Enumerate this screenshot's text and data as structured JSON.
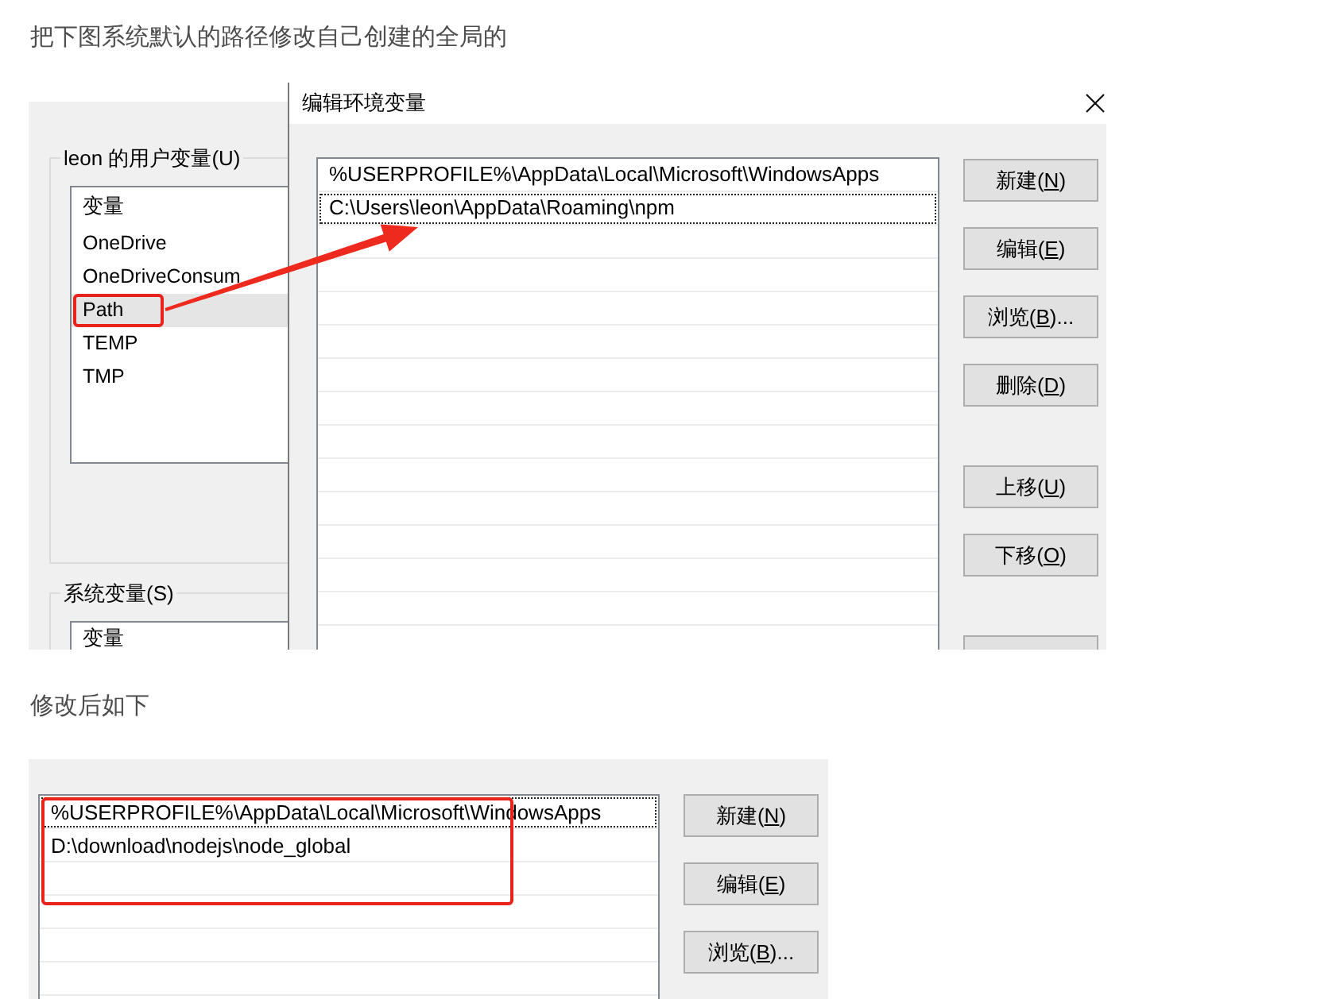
{
  "intro_text": "把下图系统默认的路径修改自己创建的全局的",
  "before_screenshot": {
    "user_variables": {
      "title": "leon 的用户变量(U)",
      "header": "变量",
      "items": [
        {
          "name": "OneDrive",
          "selected": false,
          "highlighted": false
        },
        {
          "name": "OneDriveConsum",
          "selected": false,
          "highlighted": false
        },
        {
          "name": "Path",
          "selected": true,
          "highlighted": true
        },
        {
          "name": "TEMP",
          "selected": false,
          "highlighted": false
        },
        {
          "name": "TMP",
          "selected": false,
          "highlighted": false
        }
      ]
    },
    "system_variables": {
      "title": "系统变量(S)",
      "header": "变量"
    },
    "dialog": {
      "title": "编辑环境变量",
      "paths": [
        {
          "value": "%USERPROFILE%\\AppData\\Local\\Microsoft\\WindowsApps",
          "focused": false
        },
        {
          "value": "C:\\Users\\leon\\AppData\\Roaming\\npm",
          "focused": true
        }
      ],
      "button_groups": [
        [
          {
            "before": "新建(",
            "key": "N",
            "after": ")"
          },
          {
            "before": "编辑(",
            "key": "E",
            "after": ")"
          },
          {
            "before": "浏览(",
            "key": "B",
            "after": ")..."
          },
          {
            "before": "删除(",
            "key": "D",
            "after": ")"
          }
        ],
        [
          {
            "before": "上移(",
            "key": "U",
            "after": ")"
          },
          {
            "before": "下移(",
            "key": "O",
            "after": ")"
          }
        ]
      ],
      "cut_off_button": true
    },
    "arrow": true
  },
  "after_text": "修改后如下",
  "after_screenshot": {
    "paths": [
      {
        "value": "%USERPROFILE%\\AppData\\Local\\Microsoft\\WindowsApps",
        "focused": true
      },
      {
        "value": "D:\\download\\nodejs\\node_global",
        "focused": false
      }
    ],
    "highlight": true,
    "buttons": [
      {
        "before": "新建(",
        "key": "N",
        "after": ")"
      },
      {
        "before": "编辑(",
        "key": "E",
        "after": ")"
      },
      {
        "before": "浏览(",
        "key": "B",
        "after": ")..."
      }
    ]
  }
}
